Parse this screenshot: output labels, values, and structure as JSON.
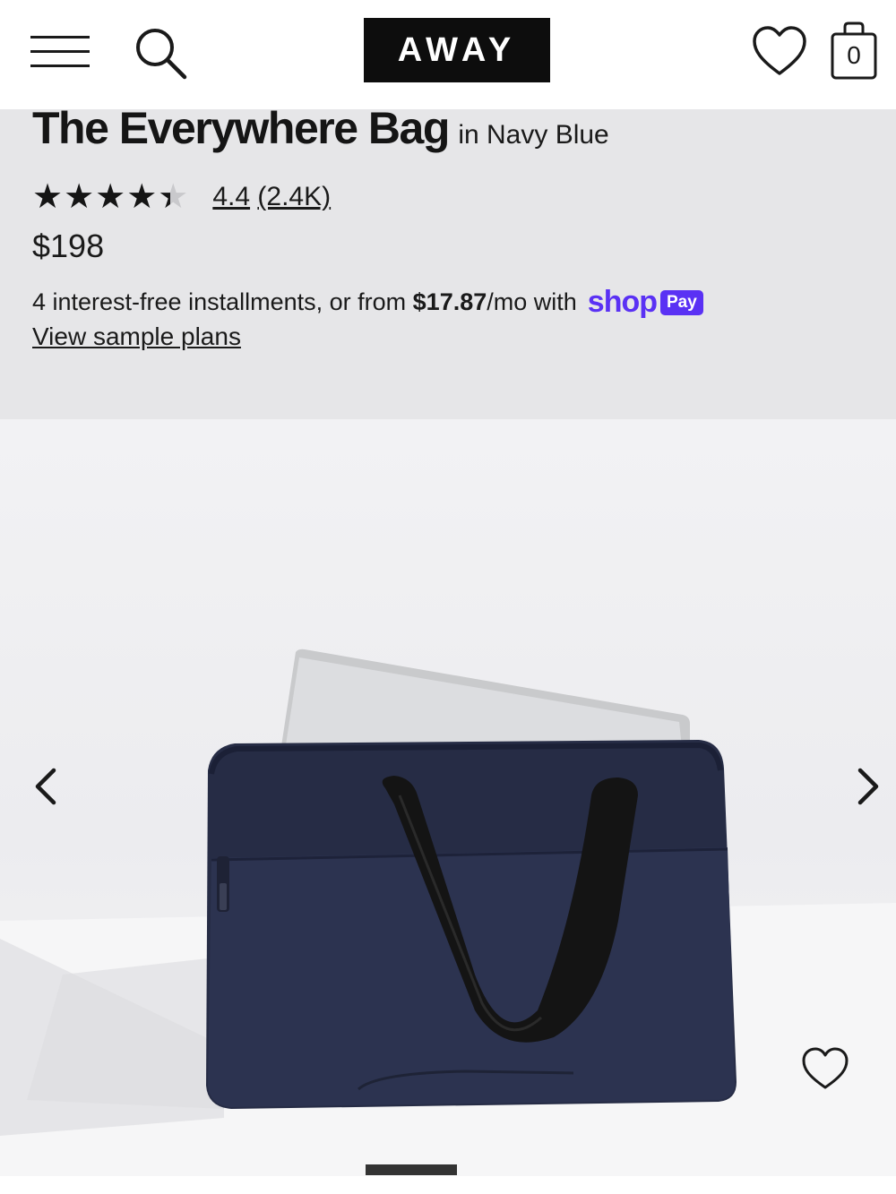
{
  "header": {
    "logo_text": "AWAY",
    "cart_count": "0"
  },
  "product": {
    "name": "The Everywhere Bag",
    "color_label": "in Navy Blue",
    "rating_value": "4.4",
    "rating_max": 5,
    "review_count": "(2.4K)",
    "price": "$198"
  },
  "financing": {
    "text_prefix": "4 interest-free installments, or from ",
    "monthly_amount": "$17.87",
    "text_suffix": "/mo with",
    "provider_logo": "shop",
    "provider_badge": "Pay",
    "sample_plans_link": "View sample plans",
    "brand_color": "#5a31f4"
  },
  "gallery": {
    "image_subject": "navy-blue-tote-bag-with-laptop",
    "current_slide_progress": 0.1,
    "bag_color": "#262c45"
  },
  "icons": {
    "menu": "hamburger-menu-icon",
    "search": "search-icon",
    "wishlist": "heart-icon",
    "cart": "shopping-bag-icon",
    "prev": "chevron-left-icon",
    "next": "chevron-right-icon"
  }
}
